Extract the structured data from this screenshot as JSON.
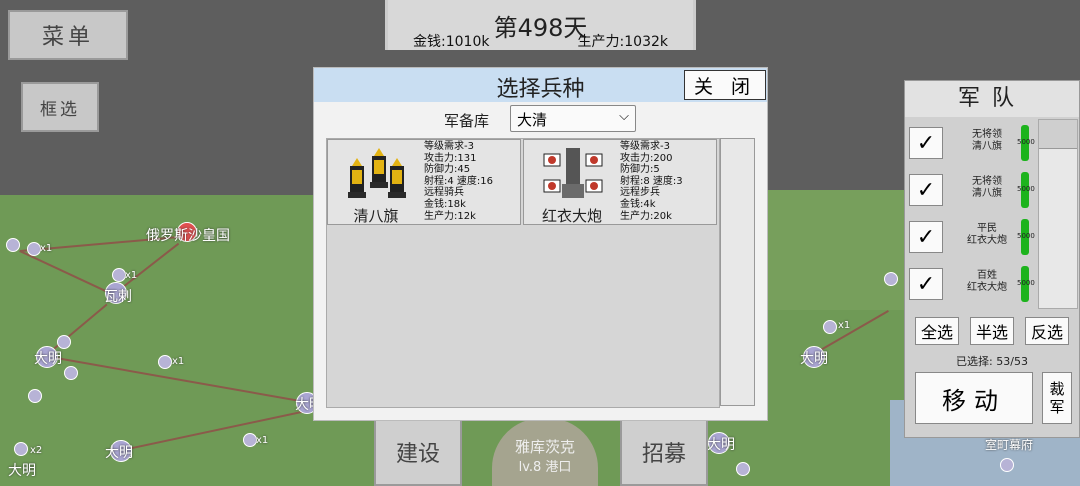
{
  "hud": {
    "day": "第498天",
    "money": "金钱:1010k",
    "production": "生产力:1032k"
  },
  "left_buttons": {
    "menu": "菜单",
    "box_select": "框选"
  },
  "bottom_buttons": {
    "build": "建设",
    "recruit": "招募",
    "city": "雅库茨克",
    "city_level": "lv.8 港口"
  },
  "map_labels": {
    "russia": "俄罗斯沙皇国",
    "walla": "瓦剌",
    "daming_1": "大明",
    "daming_2": "大明",
    "daming_3": "大明",
    "daming_4": "大明",
    "daming_5": "大明",
    "daming_6": "大明",
    "shogunate": "室町幕府",
    "x1_a": "x1",
    "x1_b": "x1",
    "x1_c": "x1",
    "x1_d": "x1",
    "x1_e": "x1",
    "x2": "x2"
  },
  "dialog": {
    "title": "选择兵种",
    "close": "关 闭",
    "armory_label": "军备库",
    "armory_value": "大清",
    "units": [
      {
        "name": "清八旗",
        "stats": [
          "等级需求-3",
          "攻击力:131",
          "防御力:45",
          "射程:4 速度:16",
          "远程骑兵",
          "金钱:18k",
          "生产力:12k"
        ]
      },
      {
        "name": "红衣大炮",
        "stats": [
          "等级需求-3",
          "攻击力:200",
          "防御力:5",
          "射程:8 速度:3",
          "远程步兵",
          "金钱:4k",
          "生产力:20k"
        ]
      }
    ]
  },
  "army": {
    "title": "军队",
    "items": [
      {
        "line1": "无将领",
        "line2": "清八旗",
        "hp": "5000",
        "check": "✓"
      },
      {
        "line1": "无将领",
        "line2": "清八旗",
        "hp": "5000",
        "check": "✓"
      },
      {
        "line1": "平民",
        "line2": "红衣大炮",
        "hp": "5000",
        "check": "✓"
      },
      {
        "line1": "百姓",
        "line2": "红衣大炮",
        "hp": "5000",
        "check": "✓"
      }
    ],
    "select_all": "全选",
    "select_half": "半选",
    "select_invert": "反选",
    "selected": "已选择: 53/53",
    "move": "移动",
    "disband": "裁军"
  },
  "colors": {
    "dialog_header": "#c9def2",
    "health_bar": "#1db31d",
    "map_land": "#6f9a56"
  }
}
